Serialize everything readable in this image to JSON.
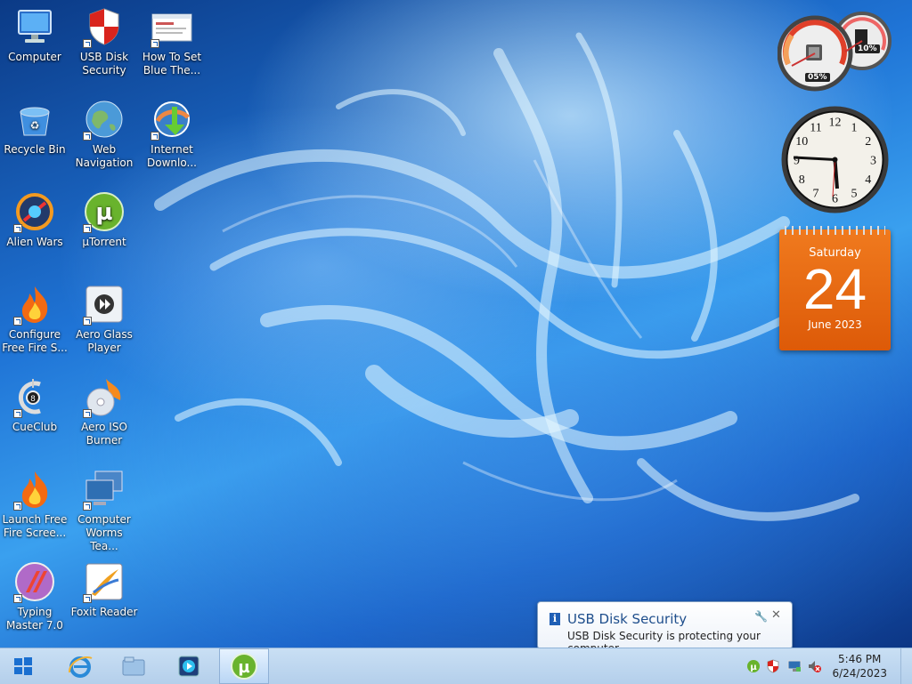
{
  "desktop": {
    "icons": [
      {
        "label": "Computer",
        "icon": "computer-icon"
      },
      {
        "label": "USB Disk Security",
        "icon": "usb-disk-security-icon"
      },
      {
        "label": "How To Set Blue The...",
        "icon": "document-icon"
      },
      {
        "label": "Recycle Bin",
        "icon": "recycle-bin-icon"
      },
      {
        "label": "Web Navigation",
        "icon": "globe-icon"
      },
      {
        "label": "Internet Downlo...",
        "icon": "internet-download-manager-icon"
      },
      {
        "label": "Alien Wars",
        "icon": "alien-wars-icon"
      },
      {
        "label": "µTorrent",
        "icon": "utorrent-icon"
      },
      {
        "label": "Configure Free Fire S...",
        "icon": "flame-icon"
      },
      {
        "label": "Aero Glass Player",
        "icon": "aero-glass-player-icon"
      },
      {
        "label": "CueClub",
        "icon": "cueclub-icon"
      },
      {
        "label": "Aero ISO Burner",
        "icon": "disc-burner-icon"
      },
      {
        "label": "Launch Free Fire Scree...",
        "icon": "flame-icon"
      },
      {
        "label": "Computer Worms Tea...",
        "icon": "monitors-icon"
      },
      {
        "label": "Typing Master 7.0",
        "icon": "typing-master-icon"
      },
      {
        "label": "Foxit Reader",
        "icon": "foxit-reader-icon"
      }
    ]
  },
  "gadgets": {
    "cpu_meter": {
      "cpu": "05%",
      "ram": "10%"
    },
    "clock": {
      "numbers": [
        "12",
        "1",
        "2",
        "3",
        "4",
        "5",
        "6",
        "7",
        "8",
        "9",
        "10",
        "11"
      ]
    },
    "calendar": {
      "weekday": "Saturday",
      "day": "24",
      "month_year": "June 2023"
    }
  },
  "notification": {
    "title": "USB Disk Security",
    "message": "USB Disk Security is protecting your computer",
    "info_glyph": "i",
    "close_glyph": "✕"
  },
  "taskbar": {
    "pinned": [
      {
        "name": "internet-explorer",
        "icon": "ie-icon"
      },
      {
        "name": "file-explorer",
        "icon": "folder-icon"
      },
      {
        "name": "media-player",
        "icon": "media-player-icon"
      },
      {
        "name": "utorrent",
        "icon": "utorrent-icon",
        "active": true
      }
    ],
    "tray": {
      "time": "5:46 PM",
      "date": "6/24/2023"
    }
  },
  "colors": {
    "calendar": "#e8681a",
    "taskbar": "#c0d8f0",
    "notification_title": "#1e4e8c"
  }
}
